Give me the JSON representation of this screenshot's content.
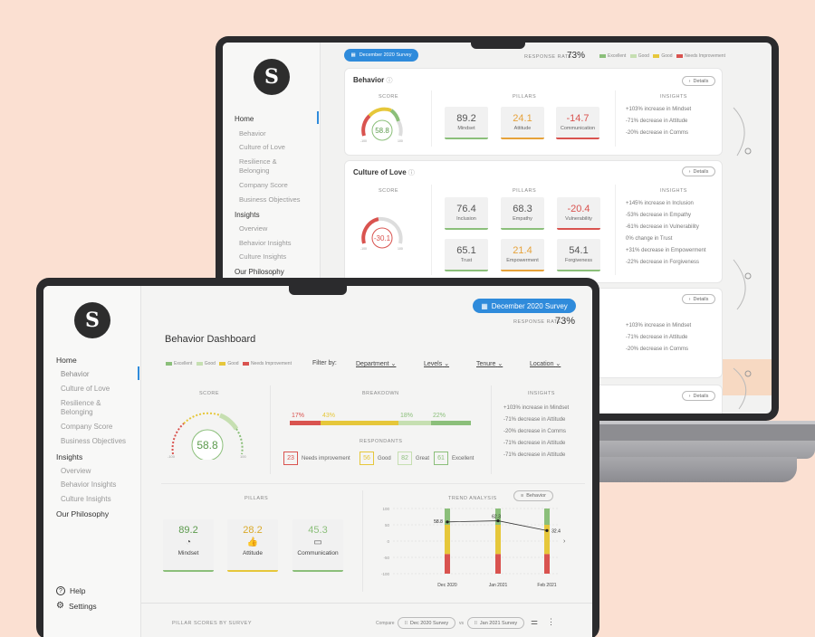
{
  "brand_letter": "S",
  "colors": {
    "green": "#8bbf7a",
    "light_green": "#c6dfb1",
    "yellow": "#e6c73a",
    "red": "#d9534f",
    "blue": "#2f8bdb",
    "orange": "#f7d9c2"
  },
  "back": {
    "survey_chip": "December 2020 Survey",
    "response_rate_label": "RESPONSE RATE",
    "response_rate": "73%",
    "legend": [
      "Excellent",
      "Good",
      "Good",
      "Needs Improvement"
    ],
    "nav": {
      "home": "Home",
      "home_items": [
        "Behavior",
        "Culture of Love",
        "Resilience &",
        "Belonging",
        "Company Score",
        "Business Objectives"
      ],
      "insights": "Insights",
      "insights_items": [
        "Overview",
        "Behavior Insights",
        "Culture Insights"
      ],
      "philosophy": "Our Philosophy"
    },
    "behavior": {
      "title": "Behavior",
      "score_label": "SCORE",
      "score": "58.8",
      "gauge_min": "-100",
      "gauge_max": "100",
      "pillars_label": "PILLARS",
      "insights_label": "INSIGHTS",
      "details": "Details",
      "pillars": [
        {
          "value": "89.2",
          "name": "Mindset",
          "color": "#8bbf7a"
        },
        {
          "value": "24.1",
          "name": "Attitude",
          "color": "#e6a23a"
        },
        {
          "value": "-14.7",
          "name": "Communication",
          "color": "#d9534f"
        }
      ],
      "insights": [
        "+103% increase in Mindset",
        "-71% decrease in Attitude",
        "-20% decrease in Comms"
      ]
    },
    "culture": {
      "title": "Culture of Love",
      "score_label": "SCORE",
      "score": "-30.1",
      "gauge_min": "-100",
      "gauge_max": "100",
      "pillars_label": "PILLARS",
      "insights_label": "INSIGHTS",
      "details": "Details",
      "pillars": [
        {
          "value": "76.4",
          "name": "Inclusion",
          "color": "#8bbf7a"
        },
        {
          "value": "68.3",
          "name": "Empathy",
          "color": "#8bbf7a"
        },
        {
          "value": "-20.4",
          "name": "Vulnerability",
          "color": "#d9534f"
        },
        {
          "value": "65.1",
          "name": "Trust",
          "color": "#8bbf7a"
        },
        {
          "value": "21.4",
          "name": "Empowerment",
          "color": "#e6a23a"
        },
        {
          "value": "54.1",
          "name": "Forgiveness",
          "color": "#8bbf7a"
        }
      ],
      "insights": [
        "+145% increase in Inclusion",
        "-53% decrease in Empathy",
        "-61% decrease in Vulnerability",
        "0% change in Trust",
        "+31% decrease in Empowerment",
        "-22% decrease in Forgiveness"
      ]
    },
    "third": {
      "details": "Details",
      "insights": [
        "+103% increase in Mindset",
        "-71% decrease in Attitude",
        "-20% decrease in Comms"
      ]
    }
  },
  "front": {
    "survey_chip": "December 2020 Survey",
    "response_rate_label": "RESPONSE RATE",
    "response_rate": "73%",
    "title": "Behavior Dashboard",
    "legend": [
      "Excellent",
      "Good",
      "Good",
      "Needs Improvement"
    ],
    "filter_label": "Filter by:",
    "filters": [
      "Department",
      "Levels",
      "Tenure",
      "Location"
    ],
    "nav": {
      "home": "Home",
      "home_items": [
        "Behavior",
        "Culture of Love",
        "Resilience &",
        "Belonging",
        "Company Score",
        "Business Objectives"
      ],
      "insights": "Insights",
      "insights_items": [
        "Overview",
        "Behavior Insights",
        "Culture Insights"
      ],
      "philosophy": "Our Philosophy",
      "help": "Help",
      "settings": "Settings"
    },
    "score": {
      "label": "SCORE",
      "value": "58.8",
      "min": "-100",
      "max": "100"
    },
    "breakdown": {
      "label": "BREAKDOWN",
      "segments": [
        {
          "pct": "17%",
          "value": 17,
          "color": "#d9534f"
        },
        {
          "pct": "43%",
          "value": 43,
          "color": "#e6c73a"
        },
        {
          "pct": "18%",
          "value": 18,
          "color": "#c6dfb1"
        },
        {
          "pct": "22%",
          "value": 22,
          "color": "#8bbf7a"
        }
      ],
      "respondants_label": "RESPONDANTS",
      "respondants": [
        {
          "count": "23",
          "label": "Needs improvement",
          "color": "#d9534f"
        },
        {
          "count": "56",
          "label": "Good",
          "color": "#e6c73a"
        },
        {
          "count": "82",
          "label": "Great",
          "color": "#c6dfb1"
        },
        {
          "count": "61",
          "label": "Excellent",
          "color": "#8bbf7a"
        }
      ]
    },
    "insights": {
      "label": "INSIGHTS",
      "items": [
        "+103% increase in Mindset",
        "-71% decrease in Attitude",
        "-20% decrease in Comms",
        "-71% decrease in Attitude",
        "-71% decrease in Attitude"
      ]
    },
    "pillars": {
      "label": "PILLARS",
      "items": [
        {
          "value": "89.2",
          "name": "Mindset",
          "color": "#8bbf7a",
          "icon": "brain-icon"
        },
        {
          "value": "28.2",
          "name": "Attitude",
          "color": "#e6c73a",
          "icon": "thumbs-up-icon"
        },
        {
          "value": "45.3",
          "name": "Communication",
          "color": "#8bbf7a",
          "icon": "chat-icon"
        }
      ]
    },
    "pillar_scores_label": "PILLAR SCORES BY SURVEY",
    "compare_label": "Compare",
    "compare_a": "Dec 2020 Survey",
    "compare_vs": "vs",
    "compare_b": "Jan 2021 Survey"
  },
  "chart_data": {
    "type": "line",
    "title": "TREND ANALYSIS",
    "dropdown": "Behavior",
    "x": [
      "Dec 2020 Survey",
      "Jan 2021 Survey",
      "Feb 2021 Survey"
    ],
    "x_lines": [
      [
        "Dec 2020",
        "Survey"
      ],
      [
        "Jan 2021",
        "Survey"
      ],
      [
        "Feb 2021",
        "Survey"
      ]
    ],
    "series": [
      {
        "values": [
          58.8,
          62.3,
          32.4
        ]
      }
    ],
    "data_labels": [
      "58.8",
      "62.3",
      "32.4"
    ],
    "yticks": [
      100,
      50,
      0,
      -50,
      -100
    ],
    "ylim": [
      -100,
      100
    ],
    "grid": true
  }
}
